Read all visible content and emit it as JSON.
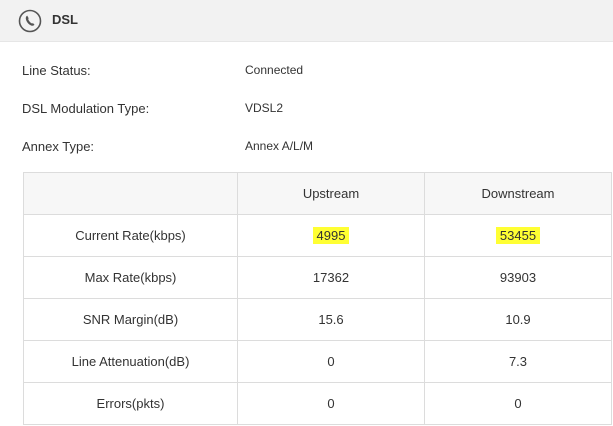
{
  "header": {
    "title": "DSL",
    "icon": "phone-circle-icon"
  },
  "info": [
    {
      "label": "Line Status:",
      "value": "Connected"
    },
    {
      "label": "DSL Modulation Type:",
      "value": "VDSL2"
    },
    {
      "label": "Annex Type:",
      "value": "Annex A/L/M"
    }
  ],
  "table": {
    "columns": [
      "",
      "Upstream",
      "Downstream"
    ],
    "rows": [
      {
        "label": "Current Rate(kbps)",
        "upstream": "4995",
        "downstream": "53455"
      },
      {
        "label": "Max Rate(kbps)",
        "upstream": "17362",
        "downstream": "93903"
      },
      {
        "label": "SNR Margin(dB)",
        "upstream": "15.6",
        "downstream": "10.9"
      },
      {
        "label": "Line Attenuation(dB)",
        "upstream": "0",
        "downstream": "7.3"
      },
      {
        "label": "Errors(pkts)",
        "upstream": "0",
        "downstream": "0"
      }
    ]
  },
  "colors": {
    "highlight": "#ffff33",
    "header_bg": "#f2f2f2",
    "border": "#dcdcdc"
  }
}
